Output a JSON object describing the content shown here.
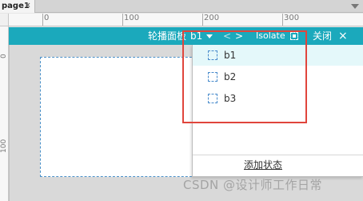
{
  "tabs": [
    {
      "label": "page1",
      "close": "×"
    }
  ],
  "ruler": {
    "h_labels": [
      "0",
      "100",
      "200",
      "300"
    ],
    "v_labels": [
      "0",
      "100"
    ]
  },
  "toolbar": {
    "panel_label": "轮播面板",
    "state_name": "b1",
    "prev": "<",
    "next": ">",
    "isolate": "Isolate",
    "close_label": "关闭",
    "close_icon": "×"
  },
  "dropdown": {
    "states": [
      {
        "label": "b1",
        "selected": true
      },
      {
        "label": "b2",
        "selected": false
      },
      {
        "label": "b3",
        "selected": false
      }
    ],
    "add_state": "添加状态"
  },
  "watermark": "CSDN @设计师工作日常",
  "colors": {
    "toolbar_bg": "#1ba9bc",
    "annotation": "#e0453c",
    "selected_row": "#e4f8fa"
  }
}
